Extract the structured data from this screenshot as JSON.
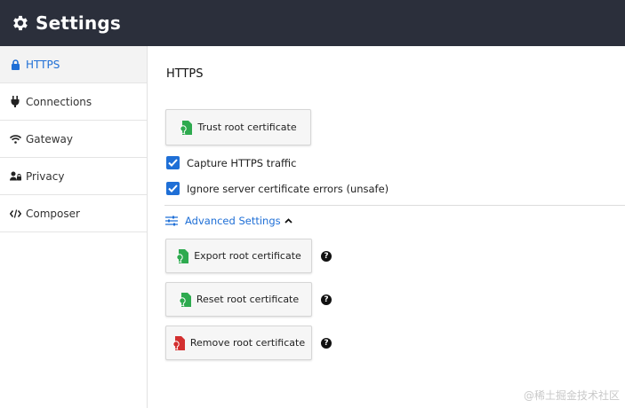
{
  "header": {
    "title": "Settings",
    "icon": "gear-icon"
  },
  "sidebar": {
    "items": [
      {
        "label": "HTTPS",
        "icon": "lock-icon",
        "active": true
      },
      {
        "label": "Connections",
        "icon": "plug-icon"
      },
      {
        "label": "Gateway",
        "icon": "wifi-icon"
      },
      {
        "label": "Privacy",
        "icon": "user-lock-icon"
      },
      {
        "label": "Composer",
        "icon": "code-icon"
      }
    ]
  },
  "main": {
    "title": "HTTPS",
    "trust_button": "Trust root certificate",
    "checkboxes": [
      {
        "label": "Capture HTTPS traffic",
        "checked": true
      },
      {
        "label": "Ignore server certificate errors (unsafe)",
        "checked": true
      }
    ],
    "advanced": {
      "label": "Advanced Settings",
      "expanded": true
    },
    "advanced_buttons": [
      {
        "label": "Export root certificate",
        "icon_color": "#2eaa4f"
      },
      {
        "label": "Reset root certificate",
        "icon_color": "#2eaa4f"
      },
      {
        "label": "Remove root certificate",
        "icon_color": "#d32f2f"
      }
    ],
    "help_glyph": "?"
  },
  "colors": {
    "accent": "#1f6fd6",
    "header_bg": "#2b2f3b",
    "cert_green": "#2eaa4f",
    "cert_red": "#d32f2f"
  },
  "watermark": "@稀土掘金技术社区"
}
